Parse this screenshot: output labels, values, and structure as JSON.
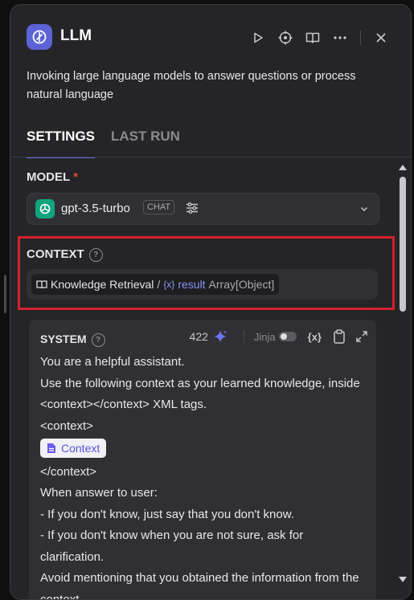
{
  "header": {
    "title": "LLM"
  },
  "description": "Invoking large language models to answer questions or process natural language",
  "tabs": [
    {
      "label": "SETTINGS"
    },
    {
      "label": "LAST RUN"
    }
  ],
  "model": {
    "label": "MODEL",
    "required_mark": "*",
    "name": "gpt-3.5-turbo",
    "mode_badge": "CHAT"
  },
  "context": {
    "label": "CONTEXT",
    "help": "?",
    "source": "Knowledge Retrieval",
    "separator": "/",
    "var_symbol": "{x}",
    "var_name": "result",
    "var_type": "Array[Object]"
  },
  "system": {
    "label": "SYSTEM",
    "help": "?",
    "token_count": "422",
    "jinja_label": "Jinja",
    "var_button": "{x}",
    "lines": [
      "You are a helpful assistant.",
      "Use the following context as your learned knowledge, inside <context></context> XML tags.",
      "<context>",
      "Context",
      "</context>",
      "When answer to user:",
      "- If you don't know, just say that you don't know.",
      "- If you don't know when you are not sure, ask for clarification.",
      "Avoid mentioning that you obtained the information from the context."
    ]
  },
  "colors": {
    "accent": "#5b63d6",
    "gpt": "#10a37f",
    "required": "#e0483f",
    "highlight": "#d4202a",
    "var": "#8b93f5"
  }
}
